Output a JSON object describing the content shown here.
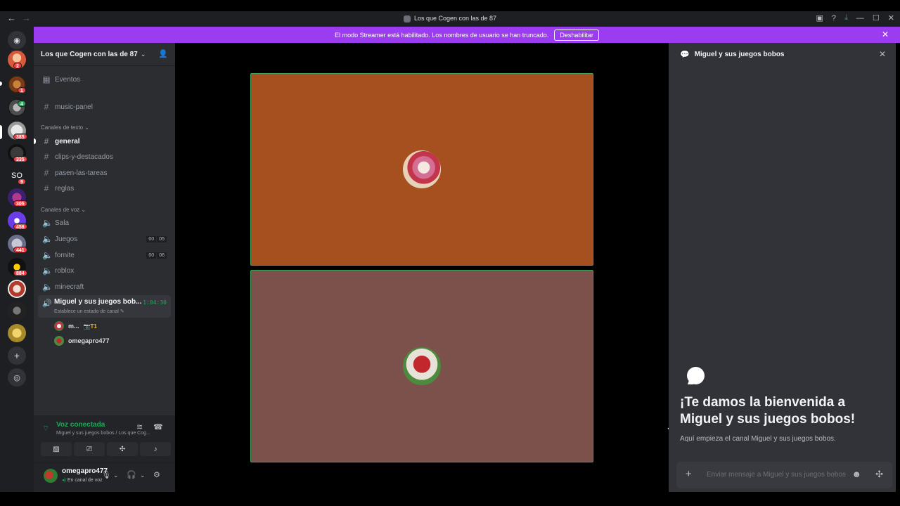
{
  "titlebar": {
    "title": "Los que Cogen con las de 87",
    "back": "←",
    "forward": "→",
    "icons": [
      "inbox-icon",
      "help-icon",
      "download-icon",
      "minimize-icon",
      "maximize-icon",
      "close-icon"
    ]
  },
  "banner": {
    "message": "El modo Streamer está habilitado. Los nombres de usuario se han truncado.",
    "button": "Deshabilitar",
    "color": "#9b3cf0"
  },
  "servers": {
    "badges": [
      "2",
      "1",
      "4",
      "385",
      "335",
      "9",
      "305",
      "456",
      "441",
      "884"
    ],
    "text_server": "SO"
  },
  "server": {
    "name": "Los que Cogen con las de 87"
  },
  "channels": {
    "events": "Eventos",
    "music": "music-panel",
    "text_category": "Canales de texto",
    "text": [
      "general",
      "clips-y-destacados",
      "pasen-las-tareas",
      "reglas"
    ],
    "voice_category": "Canales de voz",
    "voice": [
      {
        "name": "Sala"
      },
      {
        "name": "Juegos",
        "counts": [
          "00",
          "05"
        ]
      },
      {
        "name": "fornite",
        "counts": [
          "00",
          "06"
        ]
      },
      {
        "name": "roblox"
      },
      {
        "name": "minecraft"
      }
    ],
    "active_voice": {
      "name": "Miguel y sus juegos bob...",
      "status": "Establece un estado de canal",
      "timer": "1:04:30"
    },
    "voice_users": [
      {
        "name": "m...",
        "tag": "T1"
      },
      {
        "name": "omegapro477"
      }
    ]
  },
  "voice_panel": {
    "status": "Voz conectada",
    "location": "Miguel y sus juegos bobos / Los que Cog..."
  },
  "user": {
    "name": "omegapro477",
    "status": "En canal de voz"
  },
  "chat": {
    "header": "Miguel y sus juegos bobos",
    "welcome": "¡Te damos la bienvenida a Miguel y sus juegos bobos!",
    "start": "Aquí empieza el canal Miguel y sus juegos bobos.",
    "placeholder": "Enviar mensaje a Miguel y sus juegos bobos"
  },
  "colors": {
    "accent_green": "#23a55a",
    "tile1": "#a65020",
    "tile2": "#7c504b"
  }
}
